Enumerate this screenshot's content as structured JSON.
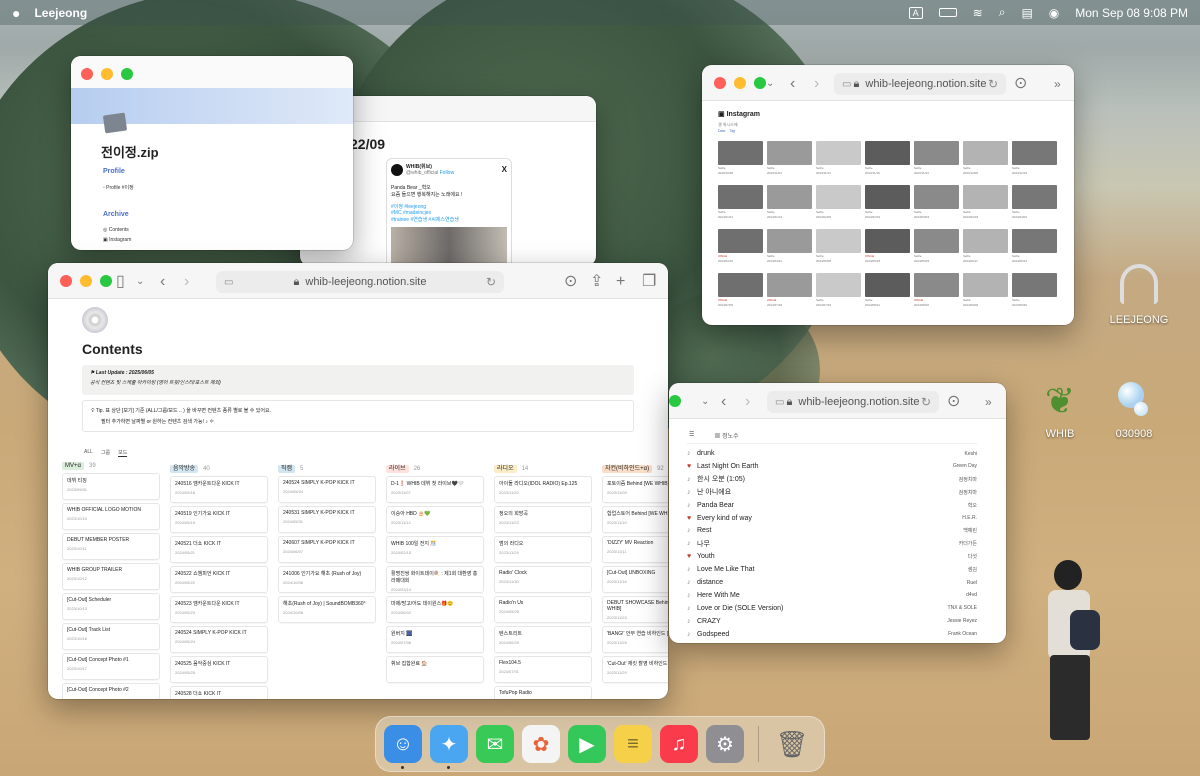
{
  "menubar": {
    "app": "Leejeong",
    "input_badge": "A",
    "clock": "Mon Sep 08  9:08 PM"
  },
  "desktop": {
    "icons": [
      {
        "label": "LEEJEONG"
      },
      {
        "label": "WHIB"
      },
      {
        "label": "030908"
      }
    ]
  },
  "profile_window": {
    "title": "전이정.zip",
    "profile_heading": "Profile",
    "profile_item": "Profile #이정",
    "archive_heading": "Archive",
    "archive_items": [
      "Contents",
      "Instagram"
    ]
  },
  "tweet_window": {
    "date": "22/09",
    "account": "WHIB(휘브)",
    "handle": "@whib_official",
    "follow": "Follow",
    "lines": [
      "Panda Bear _혁오",
      "요즘 들으면 행복해지는 노래에요 !"
    ],
    "tags": [
      "#이정 #leejeong",
      "#MC #madeincjes",
      "#trainee #연습생 #씨제스연습생"
    ]
  },
  "contents_window": {
    "url": "whib-leejeong.notion.site",
    "title": "Contents",
    "update": "Last Update : 2025/06/05",
    "update_sub": "공식 컨텐츠 및 스케줄 아카이빙 (영어 트윗/인스타/포스트 제외)",
    "tip1": "Tip. 표 상단 [보기] 기준 (ALL/그룹/보드 .. ) 을 바꾸면 컨텐츠 종류 별로 볼 수 있어요.",
    "tip2": "필터 추가하면 날짜별 or 원하는 컨텐츠 검색 가능! ♪ ✽",
    "tabs": [
      "ALL",
      "그룹",
      "보드"
    ],
    "columns": [
      {
        "tag": "MV+α",
        "count": "39",
        "bg": "#dbeddb",
        "cards": [
          [
            "데뷔 티징",
            "2023/09/01"
          ],
          [
            "WHIB OFFICIAL LOGO MOTION",
            "2023/10/10"
          ],
          [
            "DEBUT MEMBER POSTER",
            "2023/10/11"
          ],
          [
            "WHIB GROUP TRAILER",
            "2023/10/12"
          ],
          [
            "[Cut-Out] Scheduler",
            "2023/10/13"
          ],
          [
            "[Cut-Out] Track List",
            "2023/10/16"
          ],
          [
            "[Cut-Out] Concept Photo #1",
            "2023/10/17"
          ],
          [
            "[Cut-Out] Concept Photo #2",
            ""
          ]
        ]
      },
      {
        "tag": "음악방송",
        "count": "40",
        "bg": "#d3e5ef",
        "cards": [
          [
            "240516 엠카운트다운 KICK IT",
            "2024/05/16"
          ],
          [
            "240519 인기가요 KICK IT",
            "2024/05/19"
          ],
          [
            "240521 더쇼 KICK IT",
            "2024/05/21"
          ],
          [
            "240522 쇼챔피언 KICK IT",
            "2024/05/22"
          ],
          [
            "240523 엠카운트다운 KICK IT",
            "2024/05/23"
          ],
          [
            "240524 SIMPLY K-POP KICK IT",
            "2024/05/24"
          ],
          [
            "240525 음악중심 KICK IT",
            "2024/05/25"
          ],
          [
            "240528 더쇼 KICK IT",
            ""
          ]
        ]
      },
      {
        "tag": "직캠",
        "count": "5",
        "bg": "#d3e5ef",
        "cards": [
          [
            "240524 SIMPLY K-POP KICK IT",
            "2024/05/24"
          ],
          [
            "240531 SIMPLY K-POP KICK IT",
            "2024/05/31"
          ],
          [
            "240607 SIMPLY K-POP KICK IT",
            "2024/06/07"
          ],
          [
            "241006 인기가요 해초 (Rush of Joy)",
            "2024/10/06"
          ],
          [
            "해초(Rush of Joy) | SoundBOMB360°",
            "2024/10/08"
          ]
        ]
      },
      {
        "tag": "라이브",
        "count": "26",
        "bg": "#ffe2dd",
        "cards": [
          [
            "D-1❗ WHIB 데뷔 첫 라이브🖤🤍",
            "2023/11/07"
          ],
          [
            "이승아 HBD 🎂💚",
            "2023/11/12"
          ],
          [
            "WHIB 100일 전지 🎊",
            "2024/02/15"
          ],
          [
            "활명진쌍 화이트데이🍭 : 제1회 대환영 홍 라떼대회",
            "2024/03/14"
          ],
          [
            "마제/망고/어도 데이원스🎁😊",
            "2024/06/02"
          ],
          [
            "원버지 🎆",
            "2024/07/06"
          ],
          [
            "휘브 집합완료 🏠",
            ""
          ]
        ]
      },
      {
        "tag": "라디오",
        "count": "14",
        "bg": "#fdecc8",
        "cards": [
          [
            "아이돌 라디오(IDOL RADIO) Ep.125",
            "2023/11/20"
          ],
          [
            "정오의 희망곡",
            "2023/11/23"
          ],
          [
            "범의 라디오",
            "2023/11/29"
          ],
          [
            "Radio' Clock",
            "2023/11/30"
          ],
          [
            "Radio'n Us",
            "2024/05/20"
          ],
          [
            "텐스트리트",
            "2024/06/29"
          ],
          [
            "Flex104.5",
            "2024/07/01"
          ],
          [
            "TofuPop Radio",
            ""
          ]
        ]
      },
      {
        "tag": "자컨(비하인드+α)",
        "count": "92",
        "bg": "#fadec9",
        "cards": [
          [
            "포토이즘 Behind [WE WHIB]",
            "2023/11/09"
          ],
          [
            "합업스토어 Behind [WE WHIB]",
            "2023/11/10"
          ],
          [
            "'DIZZY' MV Reaction",
            "2023/11/11"
          ],
          [
            "[Cut-Out] UNBOXING",
            "2023/11/16"
          ],
          [
            "DEBUT SHOWCASE Behind [WE WHIB]",
            "2023/11/23"
          ],
          [
            "'BANG!' 안무 연습 비하인드 [WE WHIB]",
            "2023/11/25"
          ],
          [
            "'Cut-Out' 재킷 촬영 비하인드 [WE WHIB]",
            "2023/11/29"
          ]
        ]
      }
    ]
  },
  "instagram_window": {
    "url": "whib-leejeong.notion.site",
    "title": "Instagram",
    "subtitle": "갤 워시스에",
    "filters": [
      "Date",
      "Tag"
    ],
    "thumbs": [
      {
        "label": "Selfie",
        "date": "2023/10/28"
      },
      {
        "label": "Selfie",
        "date": "2023/11/04"
      },
      {
        "label": "Selfie",
        "date": "2023/11/13"
      },
      {
        "label": "Selfie",
        "date": "2023/11/19"
      },
      {
        "label": "Selfie",
        "date": "2023/11/24"
      },
      {
        "label": "Selfie",
        "date": "2023/12/06"
      },
      {
        "label": "Selfie",
        "date": "2023/12/19"
      },
      {
        "label": "Selfie",
        "date": "2024/01/01"
      },
      {
        "label": "Selfie",
        "date": "2024/01/14"
      },
      {
        "label": "Selfie",
        "date": "2024/02/05"
      },
      {
        "label": "Selfie",
        "date": "2024/02/19"
      },
      {
        "label": "Selfie",
        "date": "2024/03/03"
      },
      {
        "label": "Selfie",
        "date": "2024/03/18"
      },
      {
        "label": "Selfie",
        "date": "2024/04/02"
      },
      {
        "label": "Official",
        "date": "2024/04/16"
      },
      {
        "label": "Selfie",
        "date": "2024/04/21"
      },
      {
        "label": "Selfie",
        "date": "2024/05/08"
      },
      {
        "label": "Official",
        "date": "2024/05/18"
      },
      {
        "label": "Selfie",
        "date": "2024/05/29"
      },
      {
        "label": "Selfie",
        "date": "2024/06/11"
      },
      {
        "label": "Selfie",
        "date": "2024/06/24"
      },
      {
        "label": "Official",
        "date": "2024/07/05"
      },
      {
        "label": "Official",
        "date": "2024/07/18"
      },
      {
        "label": "Selfie",
        "date": "2024/07/29"
      },
      {
        "label": "Selfie",
        "date": "2024/08/12"
      },
      {
        "label": "Official",
        "date": "2024/08/26"
      },
      {
        "label": "Selfie",
        "date": "2024/09/08"
      },
      {
        "label": "Selfie",
        "date": "2024/09/20"
      }
    ]
  },
  "music_window": {
    "url": "whib-leejeong.notion.site",
    "tab1": "",
    "tab2": "정노수",
    "songs": [
      {
        "icon": "♪",
        "title": "drunk",
        "artist": "Keshi"
      },
      {
        "icon": "♥",
        "title": "Last Night On Earth",
        "artist": "Green Day"
      },
      {
        "icon": "♪",
        "title": "한시 오분 (1:05)",
        "artist": "검정치마"
      },
      {
        "icon": "♪",
        "title": "난 아니에요",
        "artist": "검정치마"
      },
      {
        "icon": "♪",
        "title": "Panda Bear",
        "artist": "혁오"
      },
      {
        "icon": "♥",
        "title": "Every kind of way",
        "artist": "H.E.R."
      },
      {
        "icon": "♪",
        "title": "Rest",
        "artist": "백예린"
      },
      {
        "icon": "♪",
        "title": "나무",
        "artist": "카더가든"
      },
      {
        "icon": "♥",
        "title": "Youth",
        "artist": "다섯"
      },
      {
        "icon": "♪",
        "title": "Love Me Like That",
        "artist": "샘김"
      },
      {
        "icon": "♪",
        "title": "distance",
        "artist": "Ruel"
      },
      {
        "icon": "♪",
        "title": "Here With Me",
        "artist": "d4vd"
      },
      {
        "icon": "♪",
        "title": "Love or Die (SOLE Version)",
        "artist": "TNX & SOLE"
      },
      {
        "icon": "♪",
        "title": "CRAZY",
        "artist": "Jessie Reyez"
      },
      {
        "icon": "♪",
        "title": "Godspeed",
        "artist": "Frank Ocean"
      }
    ]
  },
  "dock": {
    "apps": [
      {
        "name": "Finder",
        "color": "#3a8ee6",
        "glyph": "☺"
      },
      {
        "name": "Safari",
        "color": "#4aa6f0",
        "glyph": "✦"
      },
      {
        "name": "Messages",
        "color": "#38c956",
        "glyph": "✉"
      },
      {
        "name": "Photos",
        "color": "#f4f4f4",
        "glyph": "✿"
      },
      {
        "name": "FaceTime",
        "color": "#34c759",
        "glyph": "▶"
      },
      {
        "name": "Notes",
        "color": "#f7d04a",
        "glyph": "≡"
      },
      {
        "name": "Music",
        "color": "#fa3b4c",
        "glyph": "♫"
      },
      {
        "name": "System Settings",
        "color": "#8e8e93",
        "glyph": "⚙"
      }
    ]
  }
}
